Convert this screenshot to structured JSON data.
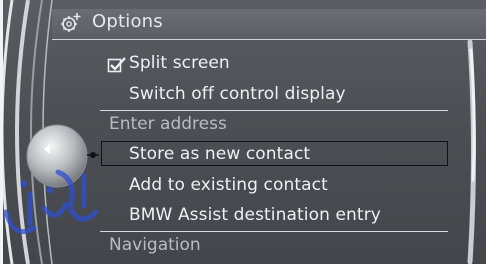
{
  "header": {
    "title": "Options",
    "icon": "gear-plus-icon"
  },
  "menu": {
    "items": [
      {
        "label": "Split screen",
        "checked": true
      },
      {
        "label": "Switch off control display"
      }
    ],
    "sections": [
      {
        "title": "Enter address",
        "items": [
          {
            "label": "Store as new contact",
            "selected": true
          },
          {
            "label": "Add to existing contact"
          },
          {
            "label": "BMW Assist destination entry"
          }
        ]
      },
      {
        "title": "Navigation"
      }
    ]
  },
  "controller": {
    "icon": "controller-left-arrow-icon"
  },
  "watermark": {
    "text": "ایران خودرو"
  },
  "colors": {
    "panel": "#4c4f53",
    "text": "#eef0f2",
    "section_text": "#b9bcc0",
    "selection_border": "#101214",
    "watermark": "#2f4fd0"
  }
}
